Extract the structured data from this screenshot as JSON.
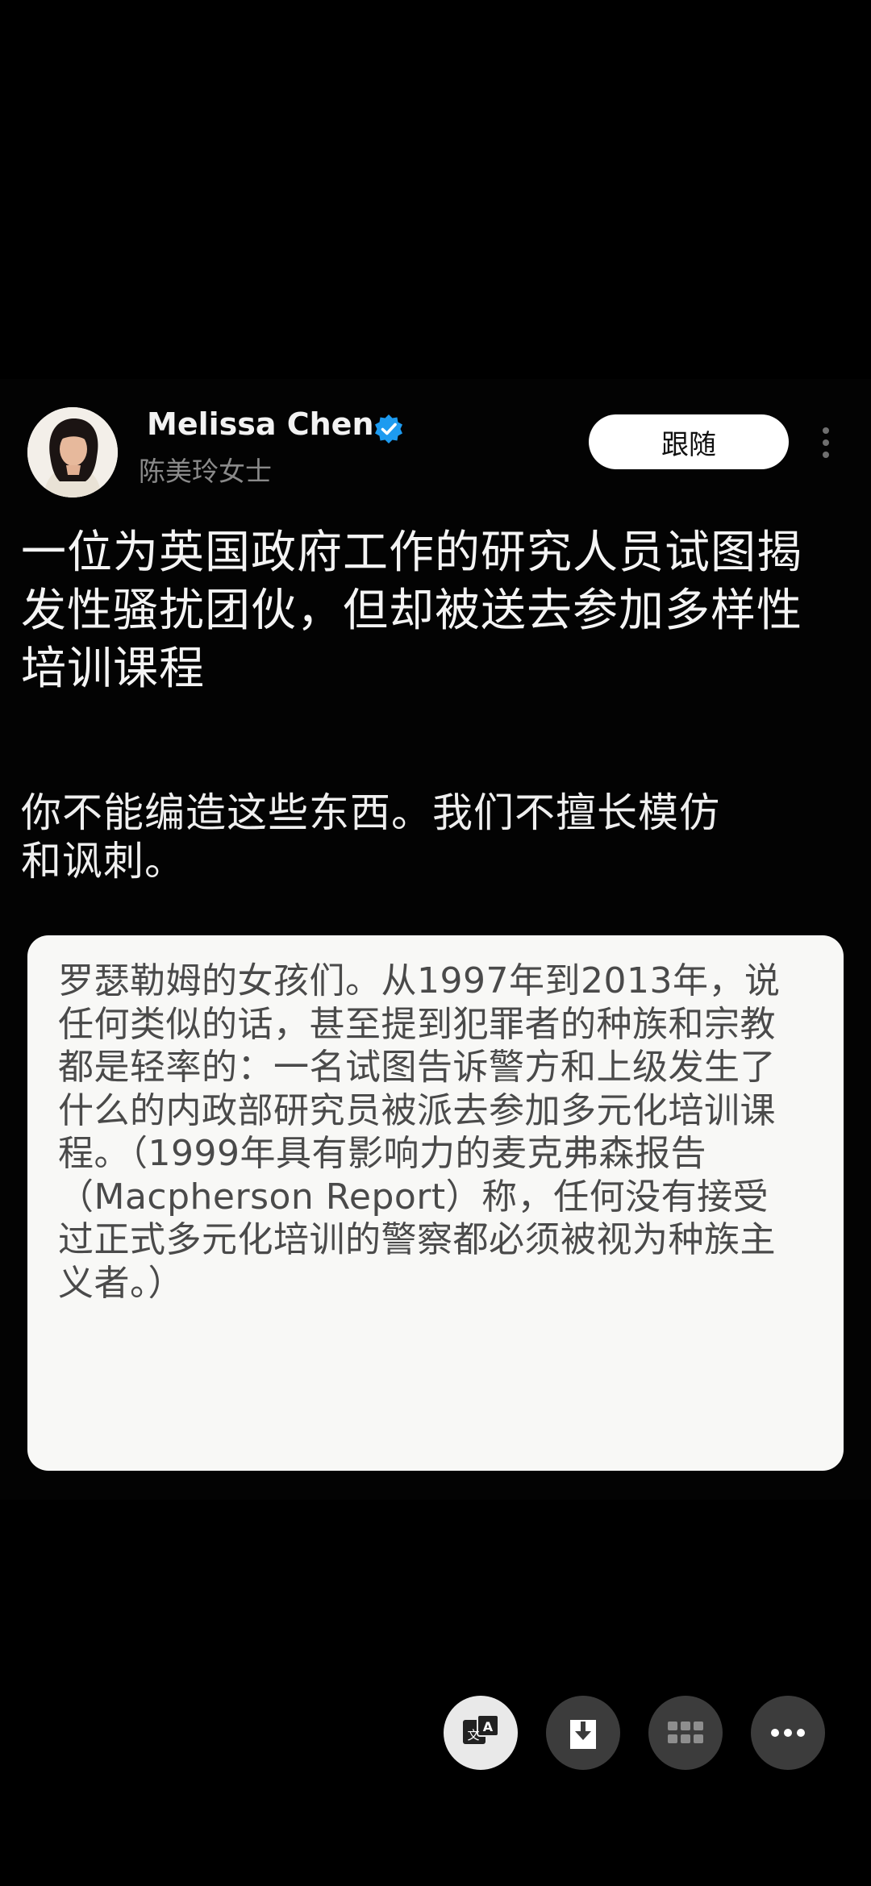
{
  "post": {
    "author": {
      "name": "Melissa Chen",
      "handle": "陈美玲女士",
      "verified_color": "#1d9bf0"
    },
    "follow_label": "跟随",
    "headline": "一位为英国政府工作的研究人员试图揭发性骚扰团伙，但却被送去参加多样性培训课程",
    "subline": "你不能编造这些东西。我们不擅长模仿和讽刺。",
    "quote": "罗瑟勒姆的女孩们。从1997年到2013年，说任何类似的话，甚至提到犯罪者的种族和宗教都是轻率的：一名试图告诉警方和上级发生了什么的内政部研究员被派去参加多元化培训课程。（1999年具有影响力的麦克弗森报告（Macpherson Report）称，任何没有接受过正式多元化培训的警察都必须被视为种族主义者。）"
  },
  "viewer_toolbar": {
    "buttons": [
      {
        "icon": "translate-icon"
      },
      {
        "icon": "download-icon"
      },
      {
        "icon": "grid-icon"
      },
      {
        "icon": "more-horizontal-icon"
      }
    ]
  },
  "colors": {
    "background": "#000000",
    "card": "#f8f8f6",
    "follow_button": "#ffffff",
    "fab_dark": "#3c3c3c",
    "fab_light": "#e9e9e9"
  }
}
